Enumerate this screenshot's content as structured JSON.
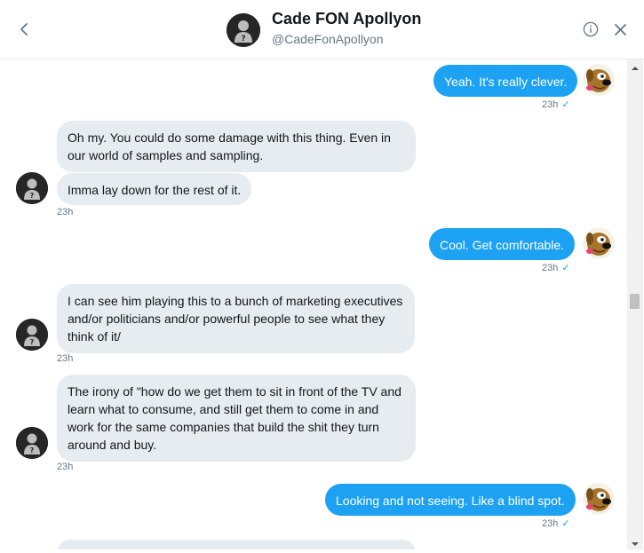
{
  "header": {
    "name": "Cade FON Apollyon",
    "handle": "@CadeFonApollyon"
  },
  "messages": [
    {
      "side": "out",
      "text": "Yeah. It's really clever.",
      "time": "23h"
    },
    {
      "side": "in",
      "text": "Oh my. You could do some damage with this thing. Even in our world of samples and sampling."
    },
    {
      "side": "in",
      "text": "Imma lay down for the rest of it.",
      "time": "23h"
    },
    {
      "side": "out",
      "text": "Cool. Get comfortable.",
      "time": "23h"
    },
    {
      "side": "in",
      "text": "I can see him playing this to a bunch of marketing executives and/or politicians and/or powerful people to see what they think of it/",
      "time": "23h"
    },
    {
      "side": "in",
      "text": "The irony of \"how do we get them to sit in front of the TV and learn what to consume, and still get them to come in and work for the same companies that build the shit they turn around and buy.",
      "time": "23h"
    },
    {
      "side": "out",
      "text": "Looking and not seeing. Like a blind spot.",
      "time": "23h"
    }
  ],
  "icons": {
    "back": "chevron-left-icon",
    "info": "info-icon",
    "close": "close-icon",
    "read_receipt": "checkmark-icon"
  },
  "colors": {
    "outgoing_bubble": "#1da1f2",
    "incoming_bubble": "#e6ecf0",
    "timestamp": "#657786"
  }
}
